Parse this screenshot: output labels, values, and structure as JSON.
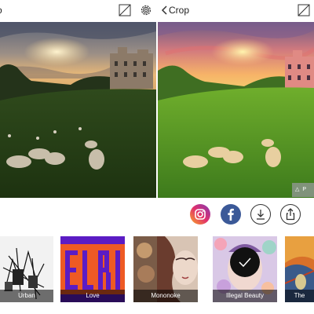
{
  "header": {
    "left_title": "o",
    "right_title": "Crop"
  },
  "filters": [
    {
      "label": "Urban",
      "selected": false
    },
    {
      "label": "Love",
      "selected": false
    },
    {
      "label": "Mononoke",
      "selected": false
    },
    {
      "label": "Illegal Beauty",
      "selected": true
    },
    {
      "label": "The",
      "selected": false
    }
  ],
  "badge": "P",
  "icons": {
    "compare_left": "compare-icon",
    "settings": "gear-icon",
    "compare_right": "compare-icon",
    "back": "chevron-left-icon",
    "instagram": "instagram-icon",
    "facebook": "facebook-icon",
    "download": "download-icon",
    "share": "share-icon",
    "check": "checkmark-icon"
  },
  "colors": {
    "facebook": "#3b5998",
    "text": "#222222"
  }
}
